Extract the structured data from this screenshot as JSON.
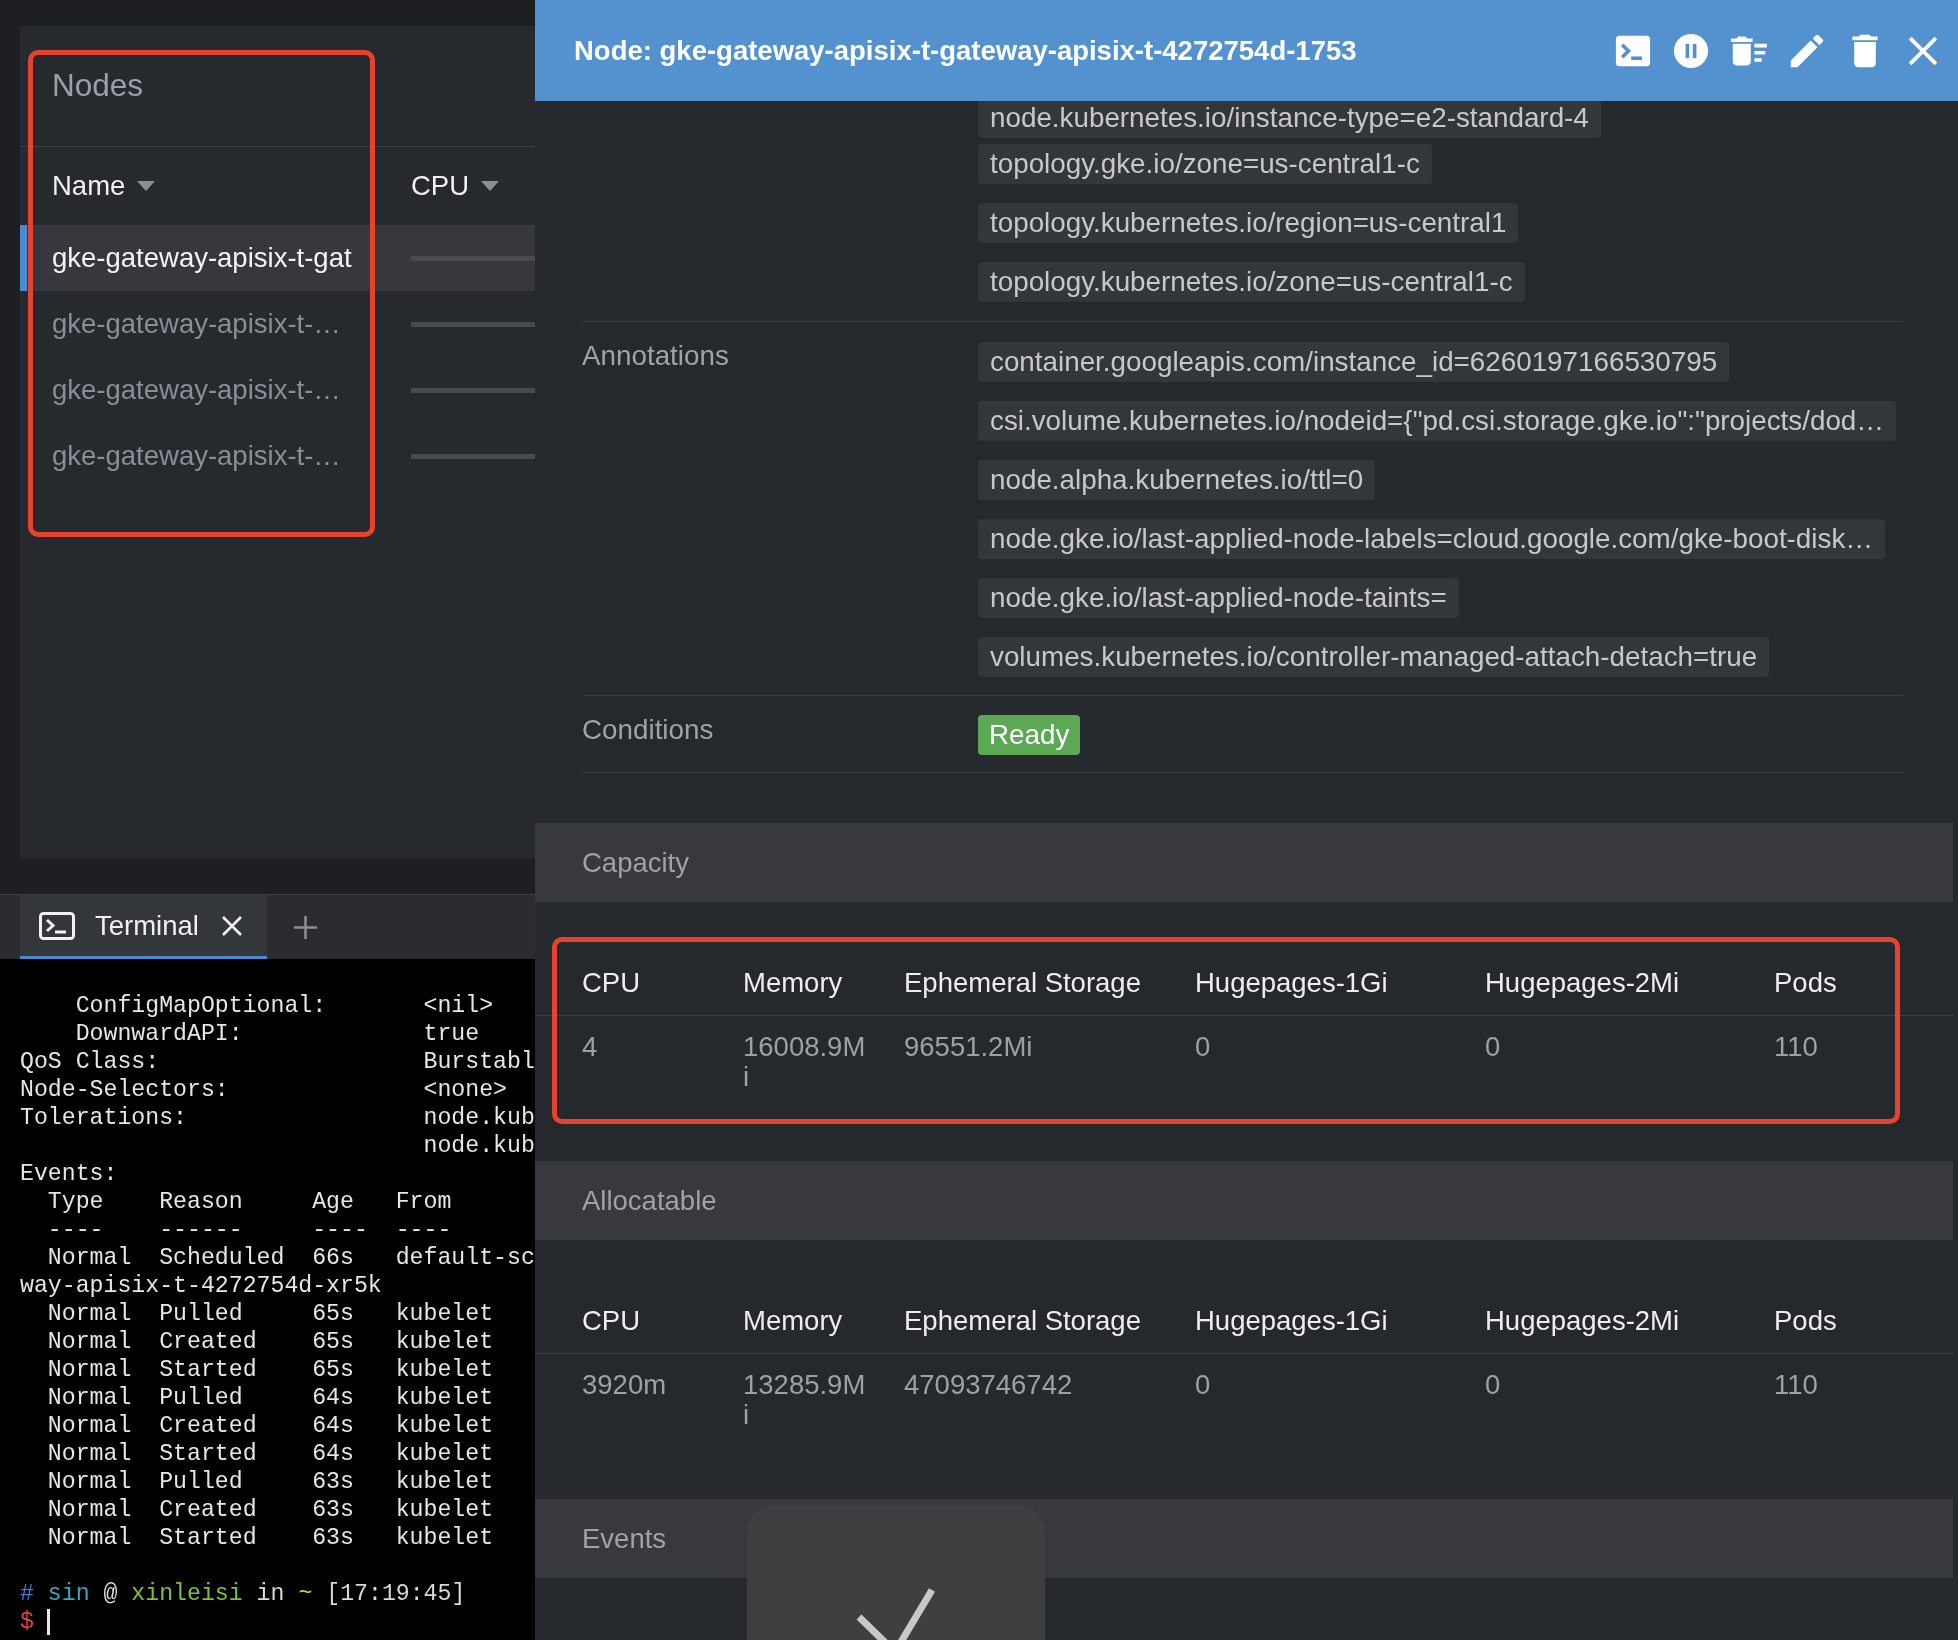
{
  "nodes_panel": {
    "title": "Nodes",
    "highlighted": true,
    "columns": [
      {
        "label": "Name"
      },
      {
        "label": "CPU"
      }
    ],
    "rows": [
      {
        "name": "gke-gateway-apisix-t-gat",
        "selected": true
      },
      {
        "name": "gke-gateway-apisix-t-…",
        "selected": false
      },
      {
        "name": "gke-gateway-apisix-t-…",
        "selected": false
      },
      {
        "name": "gke-gateway-apisix-t-…",
        "selected": false
      }
    ]
  },
  "terminal": {
    "tabs": [
      {
        "label": "Terminal",
        "selected": true
      }
    ],
    "lines": [
      "    ConfigMapOptional:       <nil>",
      "    DownwardAPI:             true",
      "QoS Class:                   Burstabl",
      "Node-Selectors:              <none>",
      "Tolerations:                 node.kub",
      "                             node.kub",
      "Events:",
      "  Type    Reason     Age   From",
      "  ----    ------     ----  ----",
      "  Normal  Scheduled  66s   default-sc",
      "way-apisix-t-4272754d-xr5k",
      "  Normal  Pulled     65s   kubelet",
      "  Normal  Created    65s   kubelet",
      "  Normal  Started    65s   kubelet",
      "  Normal  Pulled     64s   kubelet",
      "  Normal  Created    64s   kubelet",
      "  Normal  Started    64s   kubelet",
      "  Normal  Pulled     63s   kubelet",
      "  Normal  Created    63s   kubelet",
      "  Normal  Started    63s   kubelet"
    ],
    "prompt": [
      {
        "text": "#",
        "color": "#3d7fd0"
      },
      {
        "text": "sin",
        "color": "#36a9b9"
      },
      {
        "text": "@",
        "color": "#d8d8d8"
      },
      {
        "text": "xinleisi",
        "color": "#7ec13f"
      },
      {
        "text": "in",
        "color": "#d8d8d8"
      },
      {
        "text": "~",
        "color": "#d9c443"
      },
      {
        "text": "[17:19:45]",
        "color": "#d8d8d8"
      }
    ],
    "input": {
      "symbol": "$",
      "color": "#e0453d"
    }
  },
  "node_details": {
    "title": "Node: gke-gateway-apisix-t-gateway-apisix-t-4272754d-1753",
    "labels": [
      "node.kubernetes.io/instance-type=e2-standard-4",
      "topology.gke.io/zone=us-central1-c",
      "topology.kubernetes.io/region=us-central1",
      "topology.kubernetes.io/zone=us-central1-c"
    ],
    "annotations": {
      "label": "Annotations",
      "items": [
        "container.googleapis.com/instance_id=6260197166530795",
        "csi.volume.kubernetes.io/nodeid={\"pd.csi.storage.gke.io\":\"projects/dod…",
        "node.alpha.kubernetes.io/ttl=0",
        "node.gke.io/last-applied-node-labels=cloud.google.com/gke-boot-disk…",
        "node.gke.io/last-applied-node-taints=",
        "volumes.kubernetes.io/controller-managed-attach-detach=true"
      ]
    },
    "conditions": {
      "label": "Conditions",
      "items": [
        {
          "text": "Ready",
          "color": "#5ca955"
        }
      ]
    },
    "tables": [
      {
        "title": "Capacity",
        "highlighted": true,
        "columns": [
          "CPU",
          "Memory",
          "Ephemeral Storage",
          "Hugepages-1Gi",
          "Hugepages-2Mi",
          "Pods"
        ],
        "values": [
          "4",
          "16008.9Mi",
          "96551.2Mi",
          "0",
          "0",
          "110"
        ]
      },
      {
        "title": "Allocatable",
        "highlighted": false,
        "columns": [
          "CPU",
          "Memory",
          "Ephemeral Storage",
          "Hugepages-1Gi",
          "Hugepages-2Mi",
          "Pods"
        ],
        "values": [
          "3920m",
          "13285.9Mi",
          "47093746742",
          "0",
          "0",
          "110"
        ]
      }
    ],
    "events": {
      "title": "Events"
    }
  },
  "toast": {
    "shown": true
  }
}
